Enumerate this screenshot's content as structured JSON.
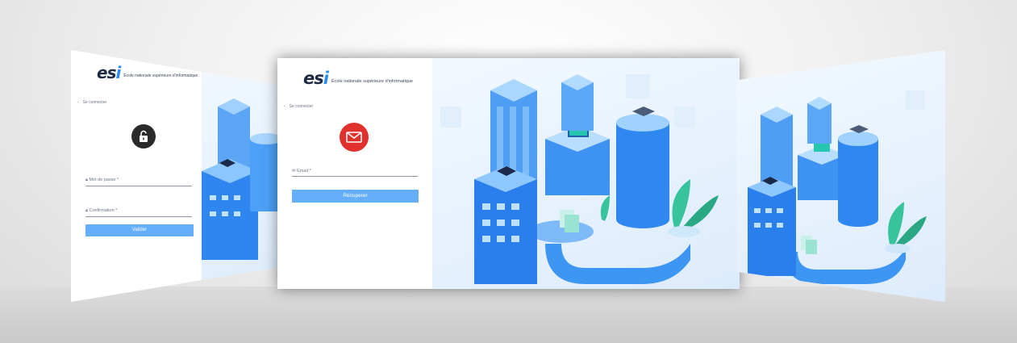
{
  "school": {
    "logo_mark": "esi",
    "name": "École nationale supérieure d'informatique"
  },
  "left_screen": {
    "back_label": "Se connecter",
    "icon": "unlock-icon",
    "fields": [
      {
        "label": "Mot de passe *",
        "icon": "lock-icon"
      },
      {
        "label": "Confirmation *",
        "icon": "lock-icon"
      }
    ],
    "button_label": "Valider"
  },
  "center_screen": {
    "back_label": "Se connecter",
    "icon": "mail-icon",
    "fields": [
      {
        "label": "Email *",
        "icon": "mail-small-icon"
      }
    ],
    "button_label": "Récuperer"
  },
  "colors": {
    "primary_button": "#64aefa",
    "mail_icon_red": "#e0312d",
    "lock_icon_dark": "#2a2a2a",
    "logo_dark": "#1d2a44"
  }
}
